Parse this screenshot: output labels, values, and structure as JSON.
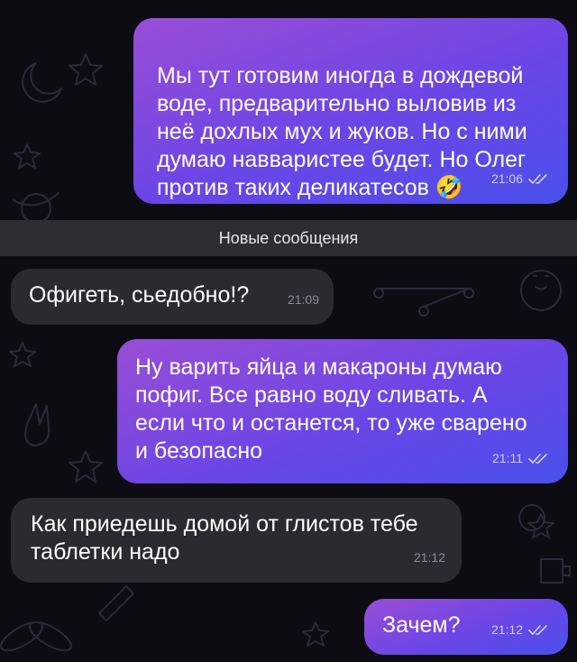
{
  "chat": {
    "divider_label": "Новые сообщения",
    "messages": [
      {
        "direction": "outgoing",
        "text": "Мы тут готовим иногда в дождевой\nводе, предварительно выловив из\nнеё дохлых мух и жуков. Но с ними\nдумаю навваристее будет. Но Олег\nпротив таких деликатесов",
        "emoji": "🤣",
        "time": "21:06",
        "status": "read"
      },
      {
        "direction": "incoming",
        "text": "Офигеть, сьедобно!?",
        "time": "21:09"
      },
      {
        "direction": "outgoing",
        "text": "Ну варить яйца и макароны думаю\nпофиг. Все равно воду сливать. А\nесли что и останется, то уже сварено\nи безопасно",
        "time": "21:11",
        "status": "read"
      },
      {
        "direction": "incoming",
        "text": "Как приедешь домой от глистов тебе\nтаблетки надо",
        "time": "21:12"
      },
      {
        "direction": "outgoing",
        "text": "Зачем?",
        "time": "21:12",
        "status": "read"
      }
    ]
  },
  "colors": {
    "background": "#0c0c12",
    "outgoing_bubble_start": "#9a4ed6",
    "outgoing_bubble_end": "#4a50ec",
    "incoming_bubble": "#2b2a30",
    "divider": "#2e2d33"
  },
  "icons": {
    "read_status": "double-check-icon",
    "background": "space-doodle-pattern"
  }
}
